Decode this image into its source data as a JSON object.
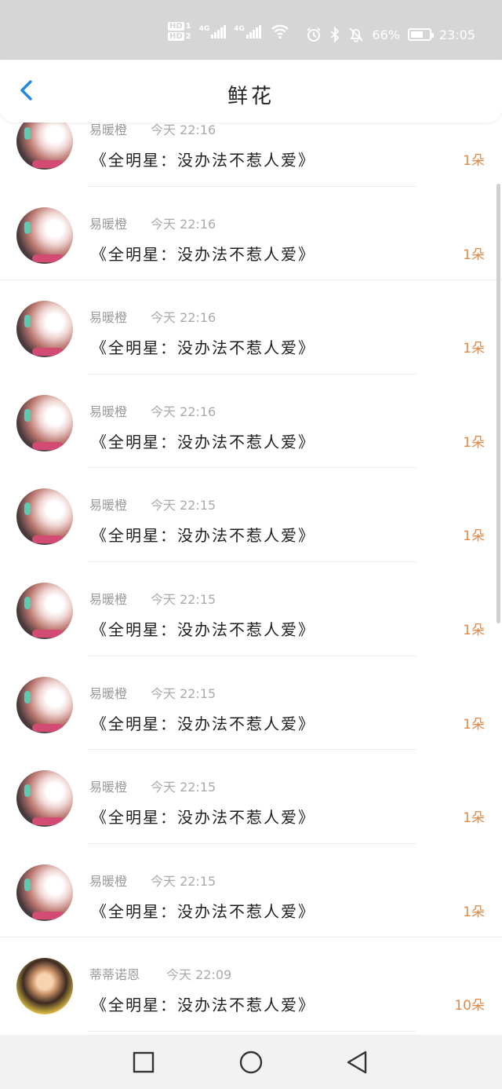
{
  "status_bar": {
    "sim1": "HD",
    "sim1_num": "1",
    "sim2": "HD",
    "sim2_num": "2",
    "net1": "4G",
    "net2": "4G",
    "battery_text": "66%",
    "battery_level": 0.66,
    "time": "23:05",
    "icons": [
      "alarm-icon",
      "bluetooth-icon",
      "mute-icon"
    ]
  },
  "header": {
    "title": "鲜花",
    "back_icon": "chevron-left-icon"
  },
  "colors": {
    "accent": "#1e88e5",
    "count": "#e08a4a",
    "status_bar": "#d6d6d6"
  },
  "records": [
    {
      "user": "易暖橙",
      "time": "今天 22:16",
      "gift": "《全明星：没办法不惹人爱》",
      "count": "1朵"
    },
    {
      "user": "易暖橙",
      "time": "今天 22:16",
      "gift": "《全明星：没办法不惹人爱》",
      "count": "1朵"
    },
    {
      "user": "易暖橙",
      "time": "今天 22:16",
      "gift": "《全明星：没办法不惹人爱》",
      "count": "1朵"
    },
    {
      "user": "易暖橙",
      "time": "今天 22:16",
      "gift": "《全明星：没办法不惹人爱》",
      "count": "1朵"
    },
    {
      "user": "易暖橙",
      "time": "今天 22:15",
      "gift": "《全明星：没办法不惹人爱》",
      "count": "1朵"
    },
    {
      "user": "易暖橙",
      "time": "今天 22:15",
      "gift": "《全明星：没办法不惹人爱》",
      "count": "1朵"
    },
    {
      "user": "易暖橙",
      "time": "今天 22:15",
      "gift": "《全明星：没办法不惹人爱》",
      "count": "1朵"
    },
    {
      "user": "易暖橙",
      "time": "今天 22:15",
      "gift": "《全明星：没办法不惹人爱》",
      "count": "1朵"
    },
    {
      "user": "易暖橙",
      "time": "今天 22:15",
      "gift": "《全明星：没办法不惹人爱》",
      "count": "1朵"
    },
    {
      "user": "蒂蒂诺恩",
      "time": "今天 22:09",
      "gift": "《全明星：没办法不惹人爱》",
      "count": "10朵"
    }
  ],
  "nav": {
    "recent_icon": "square-icon",
    "home_icon": "circle-icon",
    "back_icon": "triangle-back-icon"
  }
}
